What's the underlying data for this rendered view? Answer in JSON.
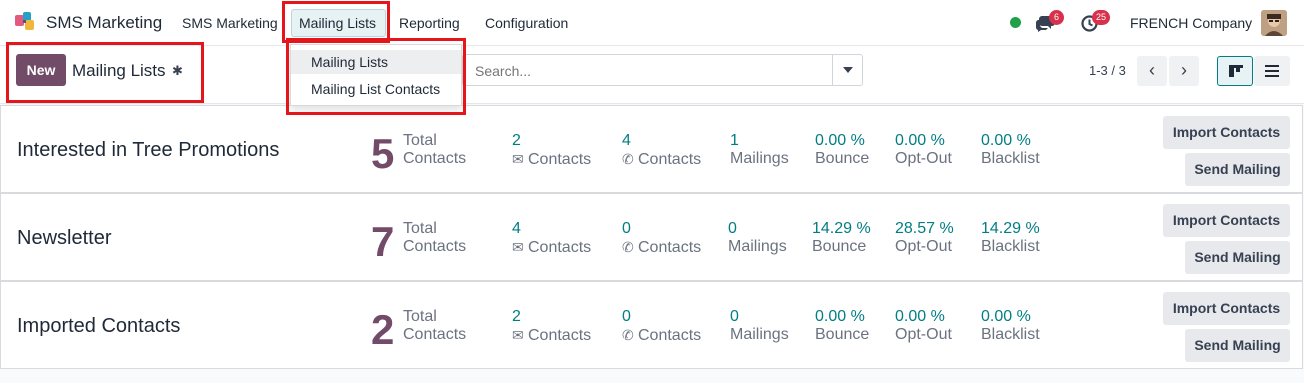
{
  "navbar": {
    "app_title": "SMS Marketing",
    "menu": [
      "SMS Marketing",
      "Mailing Lists",
      "Reporting",
      "Configuration"
    ],
    "active_menu": "Mailing Lists",
    "messages_badge": "6",
    "activities_badge": "25",
    "company": "FRENCH Company"
  },
  "dropdown": {
    "items": [
      "Mailing Lists",
      "Mailing List Contacts"
    ]
  },
  "control": {
    "new_label": "New",
    "breadcrumb": "Mailing Lists",
    "search_placeholder": "Search...",
    "pager": "1-3 / 3"
  },
  "labels": {
    "total_1": "Total",
    "total_2": "Contacts",
    "contacts": "Contacts",
    "mailings": "Mailings",
    "bounce": "Bounce",
    "optout": "Opt-Out",
    "blacklist": "Blacklist",
    "import": "Import Contacts",
    "send": "Send Mailing"
  },
  "cards": [
    {
      "name": "Interested in Tree Promotions",
      "total": "5",
      "email_contacts": "2",
      "sms_contacts": "4",
      "mailings": "1",
      "bounce": "0.00 %",
      "optout": "0.00 %",
      "blacklist": "0.00 %"
    },
    {
      "name": "Newsletter",
      "total": "7",
      "email_contacts": "4",
      "sms_contacts": "0",
      "mailings": "0",
      "bounce": "14.29 %",
      "optout": "28.57 %",
      "blacklist": "14.29 %"
    },
    {
      "name": "Imported Contacts",
      "total": "2",
      "email_contacts": "2",
      "sms_contacts": "0",
      "mailings": "0",
      "bounce": "0.00 %",
      "optout": "0.00 %",
      "blacklist": "0.00 %"
    }
  ],
  "colors": {
    "brand": "#714b67",
    "accent": "#017e84",
    "highlight": "#e4161b"
  }
}
